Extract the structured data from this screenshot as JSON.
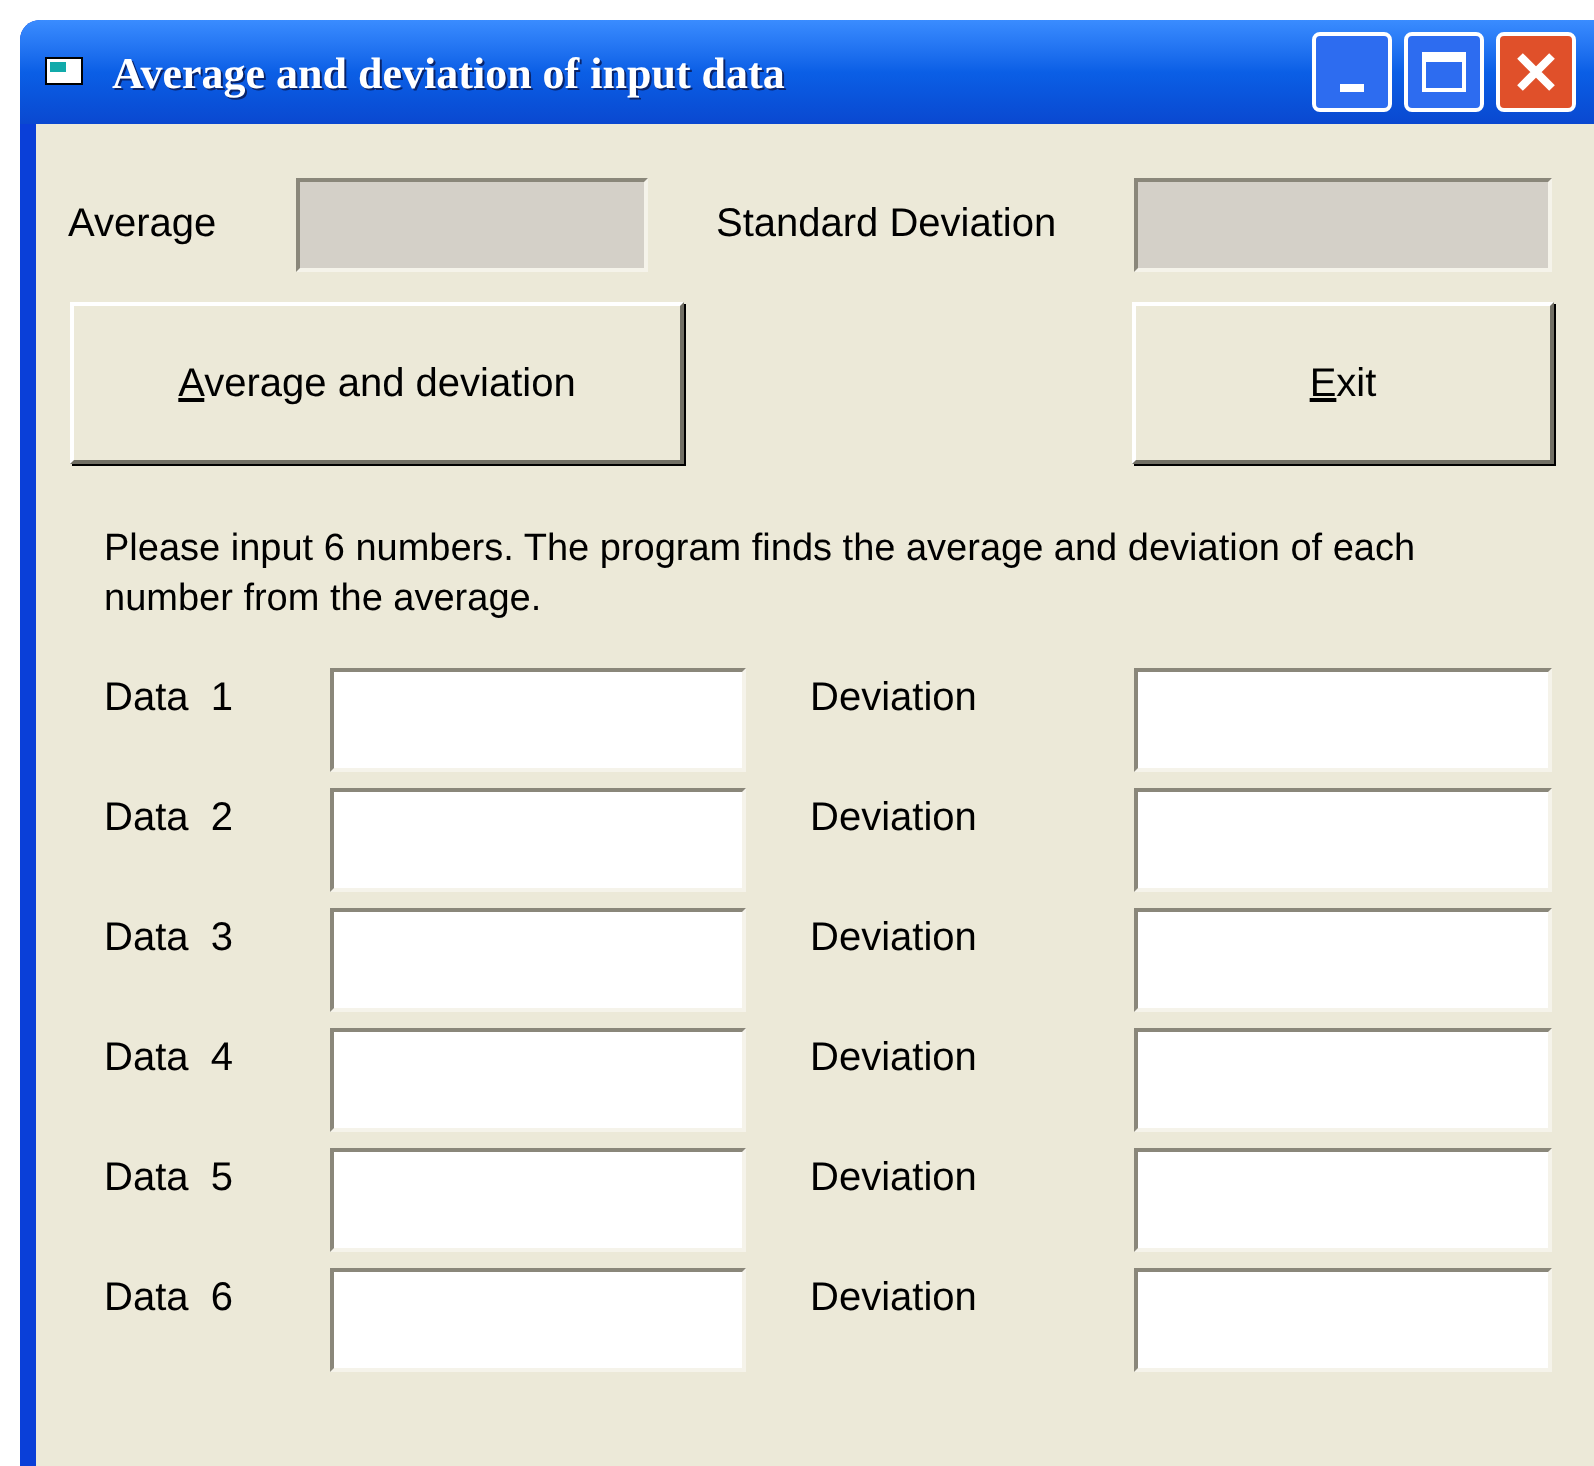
{
  "window": {
    "title": "Average and deviation of input data"
  },
  "summary": [
    {
      "label": "Average"
    },
    {
      "label": "Standard Deviation"
    }
  ],
  "buttons": [
    {
      "label": "Average and deviation",
      "mnemonic": true
    },
    {
      "label": "Exit",
      "mnemonic": true
    }
  ],
  "instructions": "Please input 6 numbers. The program finds the average and deviation of each number from the average.",
  "rows": [
    {
      "label": "Data  1",
      "deviation_label": "Deviation"
    },
    {
      "label": "Data  2",
      "deviation_label": "Deviation"
    },
    {
      "label": "Data  3",
      "deviation_label": "Deviation"
    },
    {
      "label": "Data  4",
      "deviation_label": "Deviation"
    },
    {
      "label": "Data  5",
      "deviation_label": "Deviation"
    },
    {
      "label": "Data  6",
      "deviation_label": "Deviation"
    }
  ]
}
